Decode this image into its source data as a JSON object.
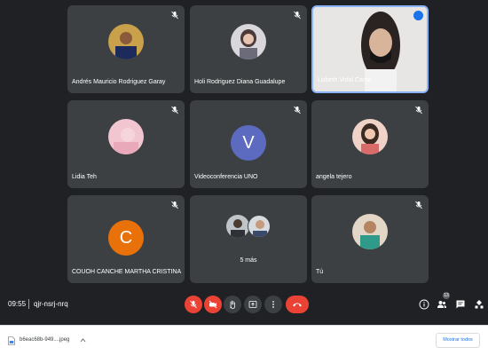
{
  "meeting": {
    "time": "09:55",
    "separator": "|",
    "code": "qjr-nsrj-nrq",
    "participant_count": "13"
  },
  "tiles": [
    {
      "name": "Andrés Mauricio Rodriguez Garay",
      "type": "photo",
      "muted": true
    },
    {
      "name": "Holi Rodriguez Diana Guadalupe",
      "type": "photo",
      "muted": true
    },
    {
      "name": "Lizbeth Vidal Canto",
      "type": "video",
      "speaking": true
    },
    {
      "name": "Lidia Teh",
      "type": "photo",
      "muted": true
    },
    {
      "name": "Videoconferencia UNO",
      "type": "letter",
      "letter": "V",
      "color": "#5c6bc0",
      "muted": true
    },
    {
      "name": "angela tejero",
      "type": "photo",
      "muted": true
    },
    {
      "name": "COUOH CANCHE MARTHA CRISTINA",
      "type": "letter",
      "letter": "C",
      "color": "#e8710a",
      "muted": true
    },
    {
      "name": "",
      "type": "more",
      "more_label": "5 más"
    },
    {
      "name": "Tú",
      "type": "photo",
      "muted": true
    }
  ],
  "controls": {
    "mic": "mic-off-icon",
    "camera": "camera-off-icon",
    "hand": "raise-hand-icon",
    "present": "present-icon",
    "more": "more-options-icon",
    "leave": "hang-up-icon"
  },
  "right_icons": [
    "info-icon",
    "people-icon",
    "chat-icon",
    "activities-icon"
  ],
  "colors": {
    "background": "#202124",
    "tile": "#3c4043",
    "danger": "#ea4335",
    "accent": "#1a73e8"
  },
  "downloads": {
    "file_name": "b6eac68b-949....jpeg",
    "show_all": "Mostrar todos"
  }
}
